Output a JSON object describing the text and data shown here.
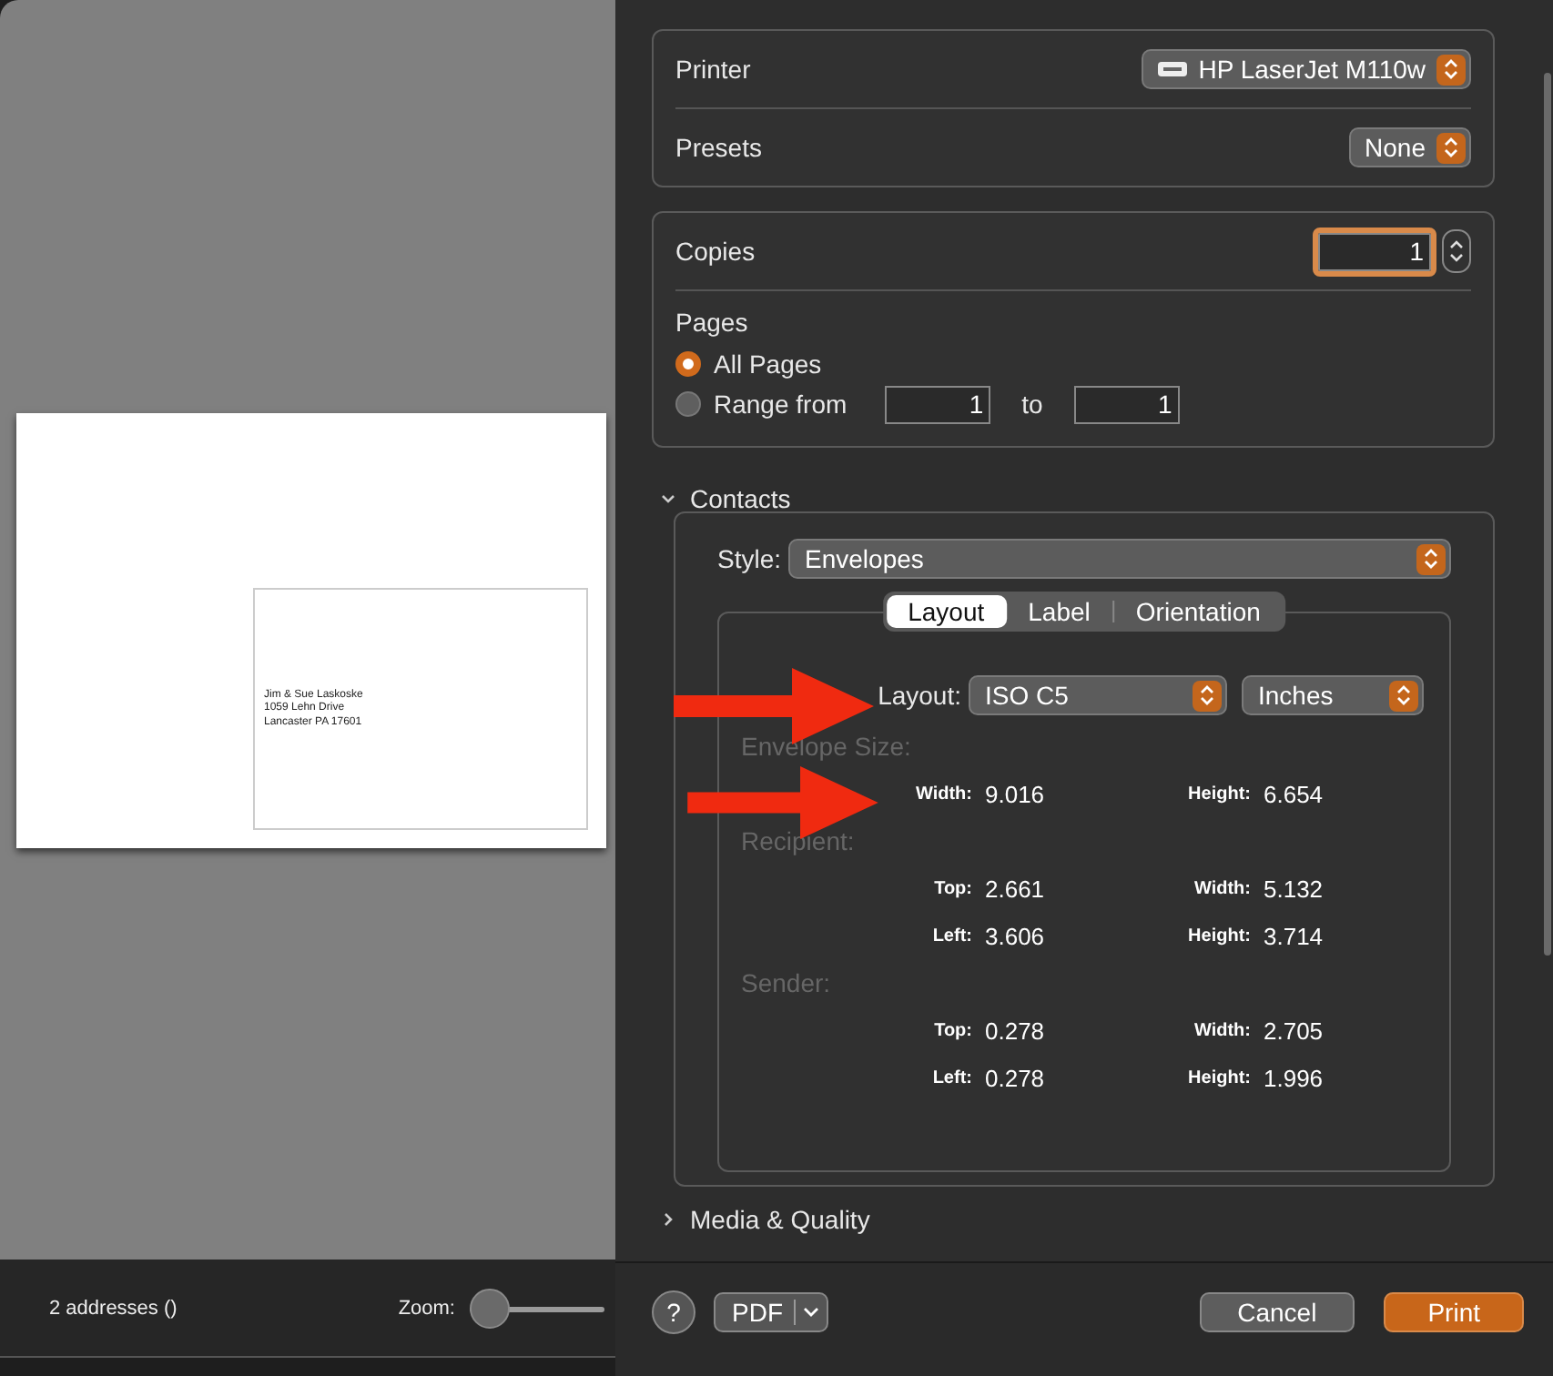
{
  "preview": {
    "address_lines": [
      "Jim & Sue Laskoske",
      "1059 Lehn Drive",
      "Lancaster PA 17601"
    ]
  },
  "preview_footer": {
    "count": "2 addresses ()",
    "zoom_label": "Zoom:",
    "zoom": {
      "level": 0
    }
  },
  "printer": {
    "label": "Printer",
    "value": "HP LaserJet M110w"
  },
  "presets": {
    "label": "Presets",
    "value": "None"
  },
  "copies": {
    "label": "Copies",
    "value": "1"
  },
  "pages": {
    "label": "Pages",
    "options": [
      {
        "label": "All Pages",
        "selected": true
      },
      {
        "label": "Range from",
        "selected": false
      }
    ],
    "range_from": "1",
    "range_to_label": "to",
    "range_to": "1"
  },
  "contacts": {
    "title": "Contacts",
    "expanded": true,
    "style_label": "Style:",
    "style": "Envelopes",
    "tabs": [
      {
        "label": "Layout",
        "selected": true
      },
      {
        "label": "Label",
        "selected": false
      },
      {
        "label": "Orientation",
        "selected": false
      }
    ],
    "layout_label": "Layout:",
    "layout": "ISO C5",
    "units": "Inches",
    "sections": [
      {
        "title": "Envelope Size:",
        "fields": [
          {
            "label": "Width:",
            "value": "9.016"
          },
          {
            "label": "Height:",
            "value": "6.654"
          }
        ]
      },
      {
        "title": "Recipient:",
        "fields": [
          {
            "label": "Top:",
            "value": "2.661"
          },
          {
            "label": "Width:",
            "value": "5.132"
          },
          {
            "label": "Left:",
            "value": "3.606"
          },
          {
            "label": "Height:",
            "value": "3.714"
          }
        ]
      },
      {
        "title": "Sender:",
        "fields": [
          {
            "label": "Top:",
            "value": "0.278"
          },
          {
            "label": "Width:",
            "value": "2.705"
          },
          {
            "label": "Left:",
            "value": "0.278"
          },
          {
            "label": "Height:",
            "value": "1.996"
          }
        ]
      }
    ]
  },
  "media_quality": {
    "title": "Media & Quality",
    "expanded": false
  },
  "footer": {
    "help": "?",
    "pdf": "PDF",
    "cancel": "Cancel",
    "print": "Print"
  }
}
